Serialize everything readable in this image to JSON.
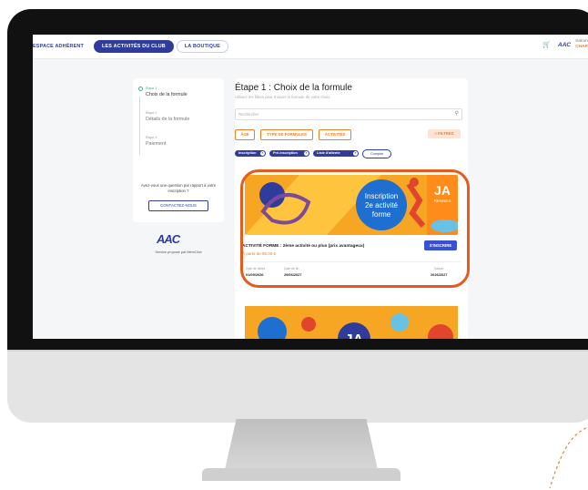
{
  "topnav": {
    "tabs": [
      {
        "label": "ESPACE ADHÉRENT"
      },
      {
        "label": "LES ACTIVITÉS DU CLUB"
      },
      {
        "label": "LA BOUTIQUE"
      }
    ],
    "logo": "AAC",
    "user_line1": "Salom",
    "user_line2": "CHAR"
  },
  "steps": [
    {
      "tag": "Étape 1",
      "label": "Choix de la formule"
    },
    {
      "tag": "Étape 2",
      "label": "Détails de la formule"
    },
    {
      "tag": "Étape 3",
      "label": "Paiement"
    }
  ],
  "sidebar": {
    "question": "Avez-vous une question par rapport à votre inscription ?",
    "contact_label": "CONTACTEZ-NOUS",
    "logo": "AAC",
    "powered_by": "Service proposé par MemClub"
  },
  "main": {
    "title": "Étape 1 : Choix de la formule",
    "subtitle": "Utilisez les filtres pour trouver la formule de votre choix",
    "search_placeholder": "Rechercher",
    "filters": [
      "ÂGE",
      "TYPE DE FORMULES",
      "ACTIVITÉS"
    ],
    "filtres_label": "FILTRES",
    "chips": [
      "Inscription",
      "Pré-inscription",
      "Liste d'attente"
    ],
    "clear_label": "Complet"
  },
  "card": {
    "banner_text": [
      "Inscription",
      "2e activité",
      "forme"
    ],
    "banner_logo": "JA",
    "banner_city": "RENNES",
    "title": "ACTIVITÉ FORME : 2ème activité ou plus (prix avantageux)",
    "price": "À partir de 95,00 €",
    "inscrire_label": "S'INSCRIRE",
    "start_label": "Date de début",
    "start_value": "01/09/2026",
    "end_label": "Date de fin",
    "end_value": "29/06/2027",
    "season_label": "Saison",
    "season_value": "2026/2027"
  },
  "card2": {
    "banner_logo": "JA"
  },
  "colors": {
    "primary": "#2f3c9c",
    "accent": "#ef7d28",
    "highlight": "#e65a1c",
    "button": "#3750d6"
  }
}
